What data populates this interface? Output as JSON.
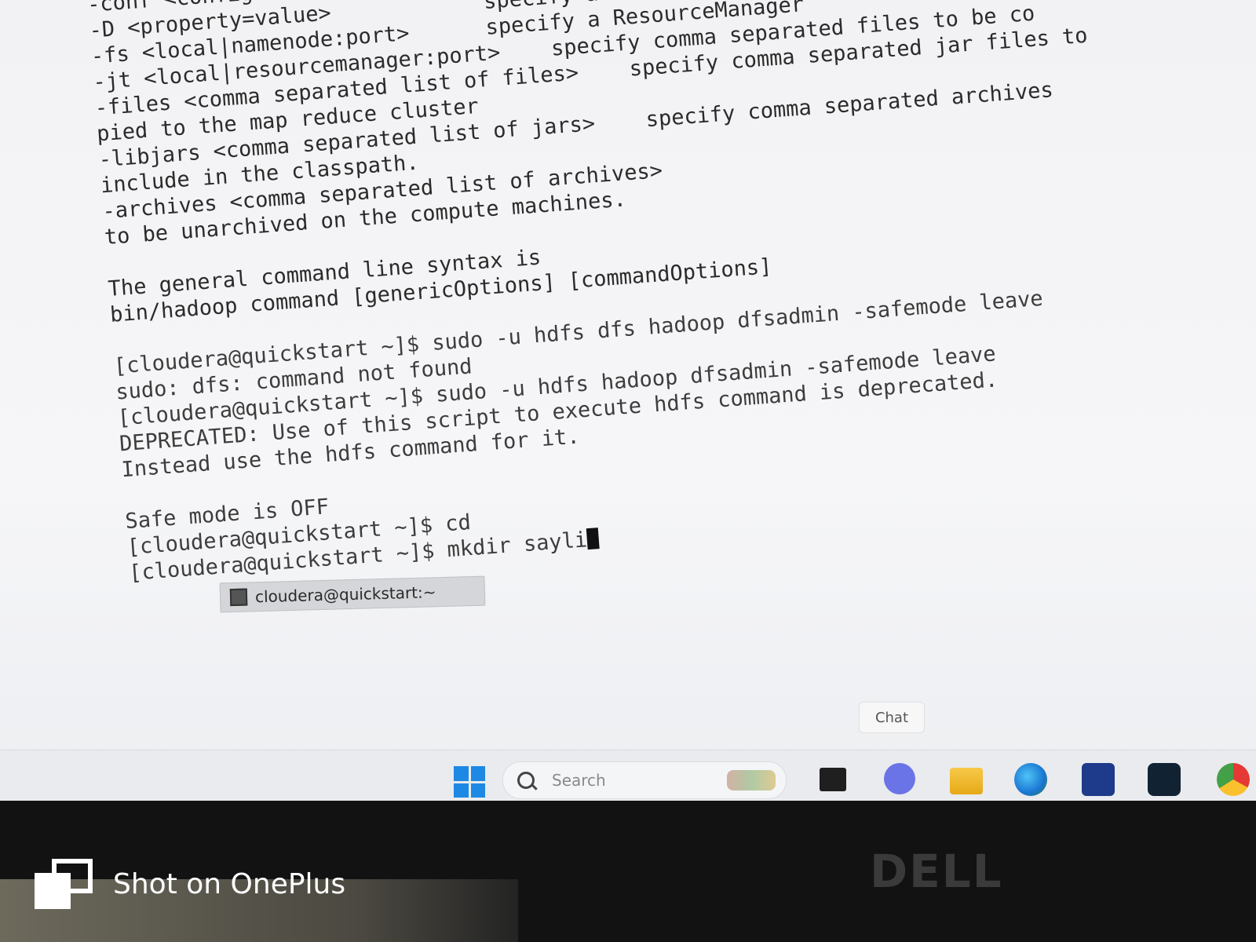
{
  "terminal": {
    "lines": [
      "-conf <configuration file>     use value",
      "-D <property=value>            specify a namenode",
      "-fs <local|namenode:port>      specify a ResourceManager",
      "-jt <local|resourcemanager:port>    specify comma separated files to be co",
      "-files <comma separated list of files>    specify comma separated jar files to",
      "pied to the map reduce cluster",
      "-libjars <comma separated list of jars>    specify comma separated archives",
      "include in the classpath.",
      "-archives <comma separated list of archives>",
      "to be unarchived on the compute machines.",
      "",
      "The general command line syntax is",
      "bin/hadoop command [genericOptions] [commandOptions]",
      "",
      "[cloudera@quickstart ~]$ sudo -u hdfs dfs hadoop dfsadmin -safemode leave",
      "sudo: dfs: command not found",
      "[cloudera@quickstart ~]$ sudo -u hdfs hadoop dfsadmin -safemode leave",
      "DEPRECATED: Use of this script to execute hdfs command is deprecated.",
      "Instead use the hdfs command for it.",
      "",
      "Safe mode is OFF",
      "[cloudera@quickstart ~]$ cd"
    ],
    "prompt_line": "[cloudera@quickstart ~]$ mkdir sayli"
  },
  "window_tab": {
    "label": "cloudera@quickstart:~",
    "icon": "terminal-icon"
  },
  "chat_tooltip": "Chat",
  "taskbar": {
    "search_placeholder": "Search",
    "icons": [
      "windows-start-icon",
      "search-icon",
      "terminal-icon",
      "chat-icon",
      "file-explorer-icon",
      "edge-icon",
      "store-icon",
      "app-icon",
      "chrome-icon"
    ]
  },
  "bezel": {
    "brand": "DELL"
  },
  "watermark": {
    "text": "Shot on OnePlus"
  }
}
